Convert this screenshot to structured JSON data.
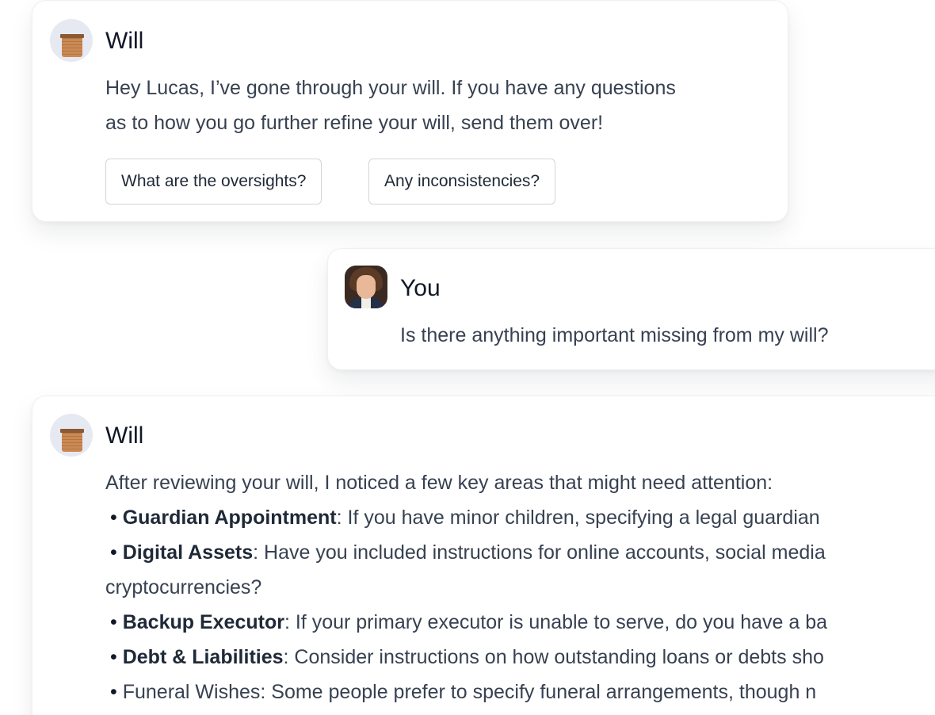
{
  "messages": [
    {
      "sender": "Will",
      "avatar_icon": "brick-box-icon",
      "text_lines": [
        "Hey Lucas, I’ve gone through your will. If you have any questions",
        "as to how you go further refine your will, send them over!"
      ],
      "suggestions": [
        "What are the oversights?",
        "Any inconsistencies?"
      ]
    },
    {
      "sender": "You",
      "avatar_icon": "user-portrait-icon",
      "text": "Is there anything important missing from my will?"
    },
    {
      "sender": "Will",
      "avatar_icon": "brick-box-icon",
      "intro": "After reviewing your will, I noticed a few key areas that might need attention:",
      "bullets": [
        {
          "bullet": "•",
          "title": "Guardian Appointment",
          "text": ": If you have minor children, specifying a legal guardian"
        },
        {
          "bullet": "•",
          "title": "Digital Assets",
          "text": ": Have you included instructions for online accounts, social media",
          "continuation": "cryptocurrencies?"
        },
        {
          "bullet": "•",
          "title": "Backup Executor",
          "text": ": If your primary executor is unable to serve, do you have a ba"
        },
        {
          "bullet": "•",
          "title": "Debt & Liabilities",
          "text": ": Consider instructions on how outstanding loans or debts sho"
        },
        {
          "bullet": "•",
          "text": "Funeral Wishes: Some people prefer to specify funeral arrangements, though n"
        }
      ]
    }
  ],
  "colors": {
    "text": "#374151",
    "name": "#111827",
    "card_border": "#eef0f3",
    "avatar_bg": "#e7e9f2",
    "pill_border": "#d1d5db"
  }
}
